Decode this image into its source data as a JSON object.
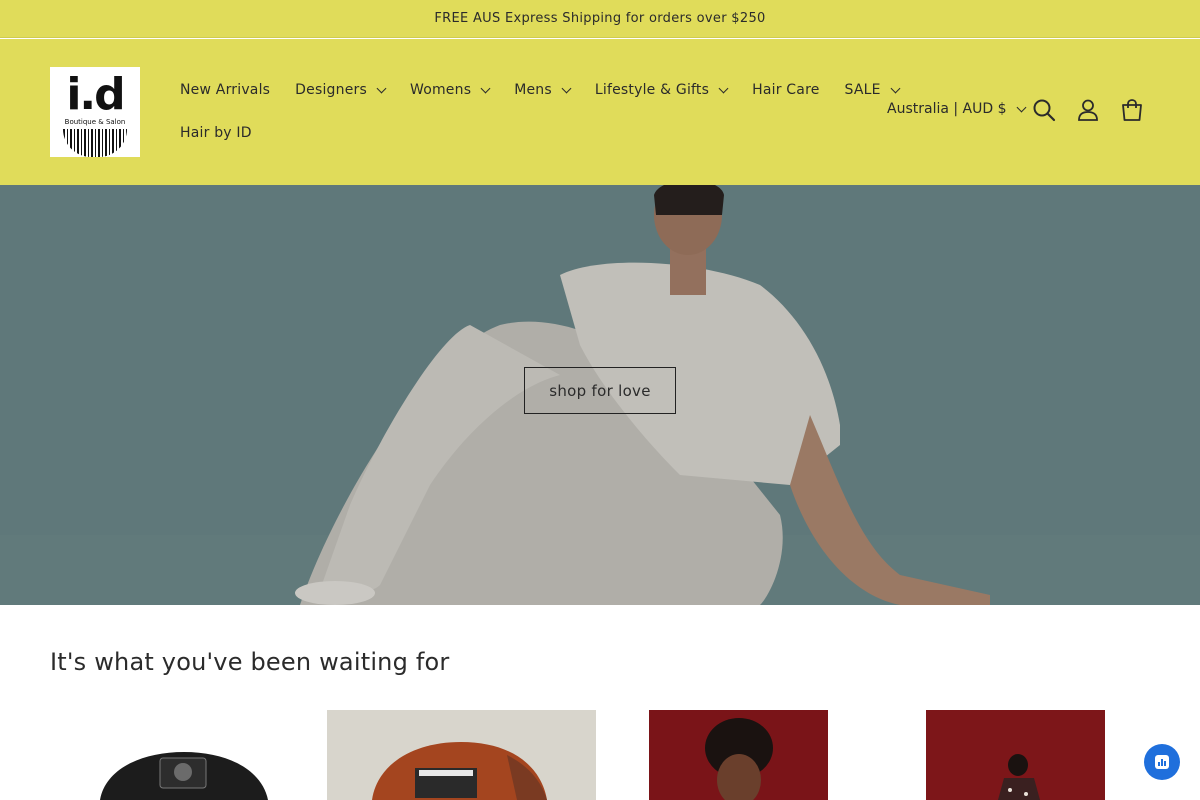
{
  "announcement": "FREE AUS Express Shipping for orders over $250",
  "logo": {
    "main": "i.d",
    "sub": "Boutique & Salon"
  },
  "nav": {
    "row1": [
      {
        "label": "New Arrivals",
        "dropdown": false
      },
      {
        "label": "Designers",
        "dropdown": true
      },
      {
        "label": "Womens",
        "dropdown": true
      },
      {
        "label": "Mens",
        "dropdown": true
      },
      {
        "label": "Lifestyle & Gifts",
        "dropdown": true
      },
      {
        "label": "Hair Care",
        "dropdown": false
      },
      {
        "label": "SALE",
        "dropdown": true
      }
    ],
    "row2": [
      {
        "label": "Hair by ID",
        "dropdown": false
      }
    ]
  },
  "locale": "Australia | AUD $",
  "icons": [
    "search-icon",
    "account-icon",
    "cart-icon",
    "chevron-down-icon",
    "chat-icon"
  ],
  "hero": {
    "button": "shop for love"
  },
  "collection": {
    "title": "It's what you've been waiting for"
  },
  "colors": {
    "header_bg": "#e0dc5a",
    "hero_bg": "#6f8a8c",
    "chat_button": "#1f6fdc"
  }
}
